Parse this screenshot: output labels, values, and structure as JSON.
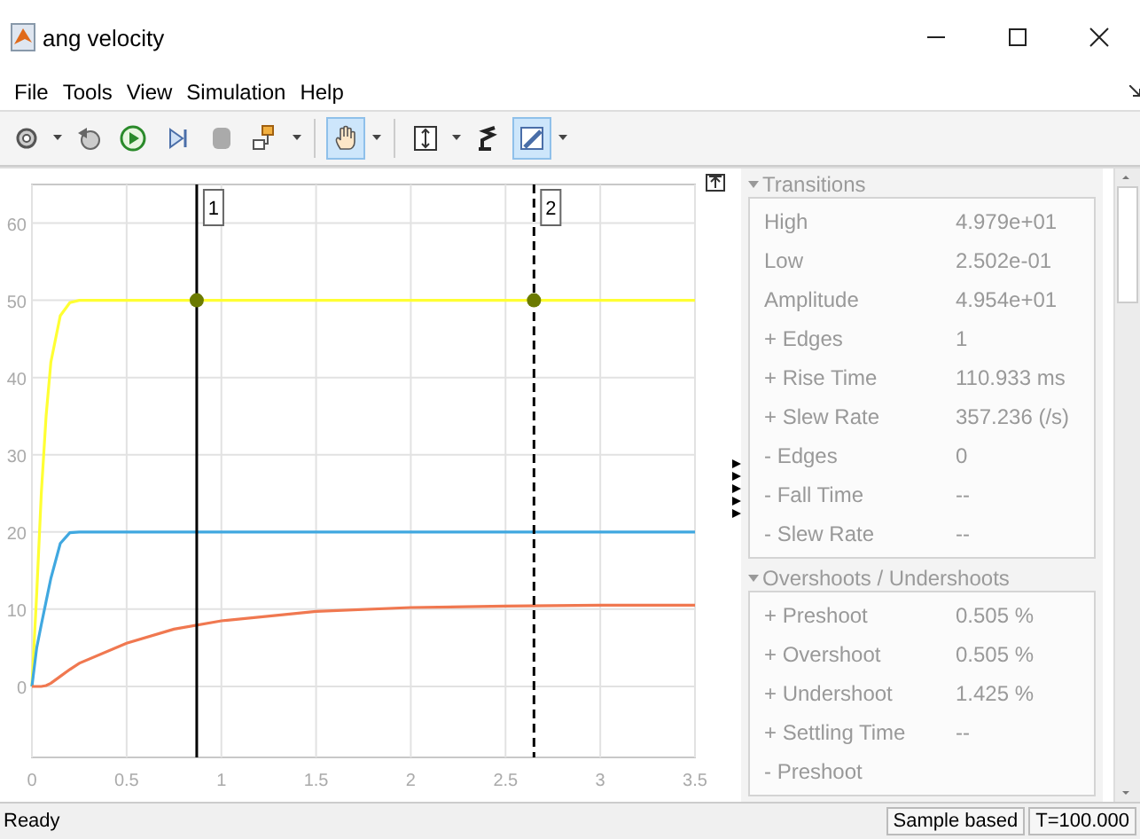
{
  "window": {
    "title": "ang velocity"
  },
  "menu": [
    "File",
    "Tools",
    "View",
    "Simulation",
    "Help"
  ],
  "toolbar": [
    {
      "kind": "settings",
      "dropdown": true,
      "pressed": false
    },
    {
      "kind": "step-back",
      "dropdown": false,
      "pressed": false
    },
    {
      "kind": "run",
      "dropdown": false,
      "pressed": false
    },
    {
      "kind": "step-forward",
      "dropdown": false,
      "pressed": false
    },
    {
      "kind": "stop",
      "dropdown": false,
      "pressed": false
    },
    {
      "kind": "blocks",
      "dropdown": true,
      "pressed": false
    },
    {
      "kind": "separator"
    },
    {
      "kind": "pan",
      "dropdown": true,
      "pressed": true
    },
    {
      "kind": "separator"
    },
    {
      "kind": "scale",
      "dropdown": true,
      "pressed": false
    },
    {
      "kind": "triggers",
      "dropdown": false,
      "pressed": false
    },
    {
      "kind": "measure",
      "dropdown": true,
      "pressed": true
    }
  ],
  "plot": {
    "chart_data": {
      "type": "line",
      "x": [
        0,
        0.025,
        0.05,
        0.075,
        0.1,
        0.15,
        0.2,
        0.25,
        0.5,
        0.75,
        1,
        1.5,
        2,
        2.5,
        3,
        3.5
      ],
      "series": [
        {
          "color": "#ffff33",
          "values": [
            0,
            12,
            25,
            35,
            42,
            48,
            49.7,
            50,
            50,
            50,
            50,
            50,
            50,
            50,
            50,
            50
          ]
        },
        {
          "color": "#40a8e0",
          "values": [
            0,
            5,
            8,
            11,
            14,
            18.5,
            19.9,
            20,
            20,
            20,
            20,
            20,
            20,
            20,
            20,
            20
          ]
        },
        {
          "color": "#f07850",
          "values": [
            0,
            0,
            0,
            0.1,
            0.4,
            1.3,
            2.2,
            3,
            5.6,
            7.4,
            8.5,
            9.7,
            10.2,
            10.4,
            10.5,
            10.5
          ]
        }
      ],
      "xlim": [
        0,
        3.5
      ],
      "ylim": [
        -9.2,
        65
      ],
      "grid": true,
      "xticks": [
        {
          "value": 0,
          "label": "0"
        },
        {
          "value": 0.5,
          "label": "0.5"
        },
        {
          "value": 1,
          "label": "1"
        },
        {
          "value": 1.5,
          "label": "1.5"
        },
        {
          "value": 2,
          "label": "2"
        },
        {
          "value": 2.5,
          "label": "2.5"
        },
        {
          "value": 3,
          "label": "3"
        },
        {
          "value": 3.5,
          "label": "3.5"
        }
      ],
      "yticks": [
        0,
        10,
        20,
        30,
        40,
        50,
        60
      ],
      "ref_lines": [
        {
          "axis": "x",
          "value": 0.87
        },
        {
          "axis": "x",
          "value": 2.65
        }
      ]
    },
    "cursors": [
      {
        "label": "1",
        "dashed": false
      },
      {
        "label": "2",
        "dashed": true
      }
    ]
  },
  "measurements": [
    {
      "title": "Transitions",
      "expanded": true,
      "rows": [
        {
          "label": "High",
          "value": "4.979e+01"
        },
        {
          "label": "Low",
          "value": "2.502e-01"
        },
        {
          "label": "Amplitude",
          "value": "4.954e+01"
        },
        {
          "label": "+ Edges",
          "value": "1"
        },
        {
          "label": "+ Rise Time",
          "value": "110.933 ms"
        },
        {
          "label": "+ Slew Rate",
          "value": "357.236 (/s)"
        },
        {
          "label": "- Edges",
          "value": "0"
        },
        {
          "label": "- Fall Time",
          "value": "--"
        },
        {
          "label": "- Slew Rate",
          "value": "--"
        }
      ]
    },
    {
      "title": "Overshoots / Undershoots",
      "expanded": true,
      "rows": [
        {
          "label": "+ Preshoot",
          "value": "0.505 %"
        },
        {
          "label": "+ Overshoot",
          "value": "0.505 %"
        },
        {
          "label": "+ Undershoot",
          "value": "1.425 %"
        },
        {
          "label": "+ Settling Time",
          "value": "--"
        },
        {
          "label": "- Preshoot"
        }
      ]
    }
  ],
  "status_bar": {
    "message": "Ready",
    "mode": "Sample based",
    "time": "T=100.000"
  }
}
